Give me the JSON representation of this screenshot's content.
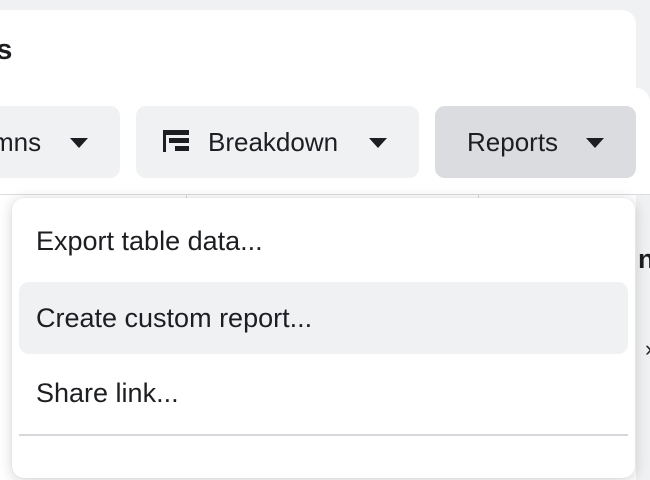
{
  "panel": {
    "title_fragment": "ls"
  },
  "toolbar": {
    "columns_label": "mns",
    "breakdown_label": "Breakdown",
    "reports_label": "Reports",
    "active_button": "Reports"
  },
  "background_table": {
    "header_fragment": "ns",
    "row_fragment": "›"
  },
  "reports_menu": {
    "items": [
      {
        "label": "Export table data..."
      },
      {
        "label": "Create custom report..."
      },
      {
        "label": "Share link..."
      }
    ],
    "hovered_index": 1
  },
  "icons": {
    "breakdown": "breakdown-icon",
    "caret": "caret-down-icon"
  },
  "colors": {
    "button_bg": "#f0f1f3",
    "button_active_bg": "#dadcdf",
    "menu_hover_bg": "#f0f1f3",
    "text": "#1c1e21"
  }
}
